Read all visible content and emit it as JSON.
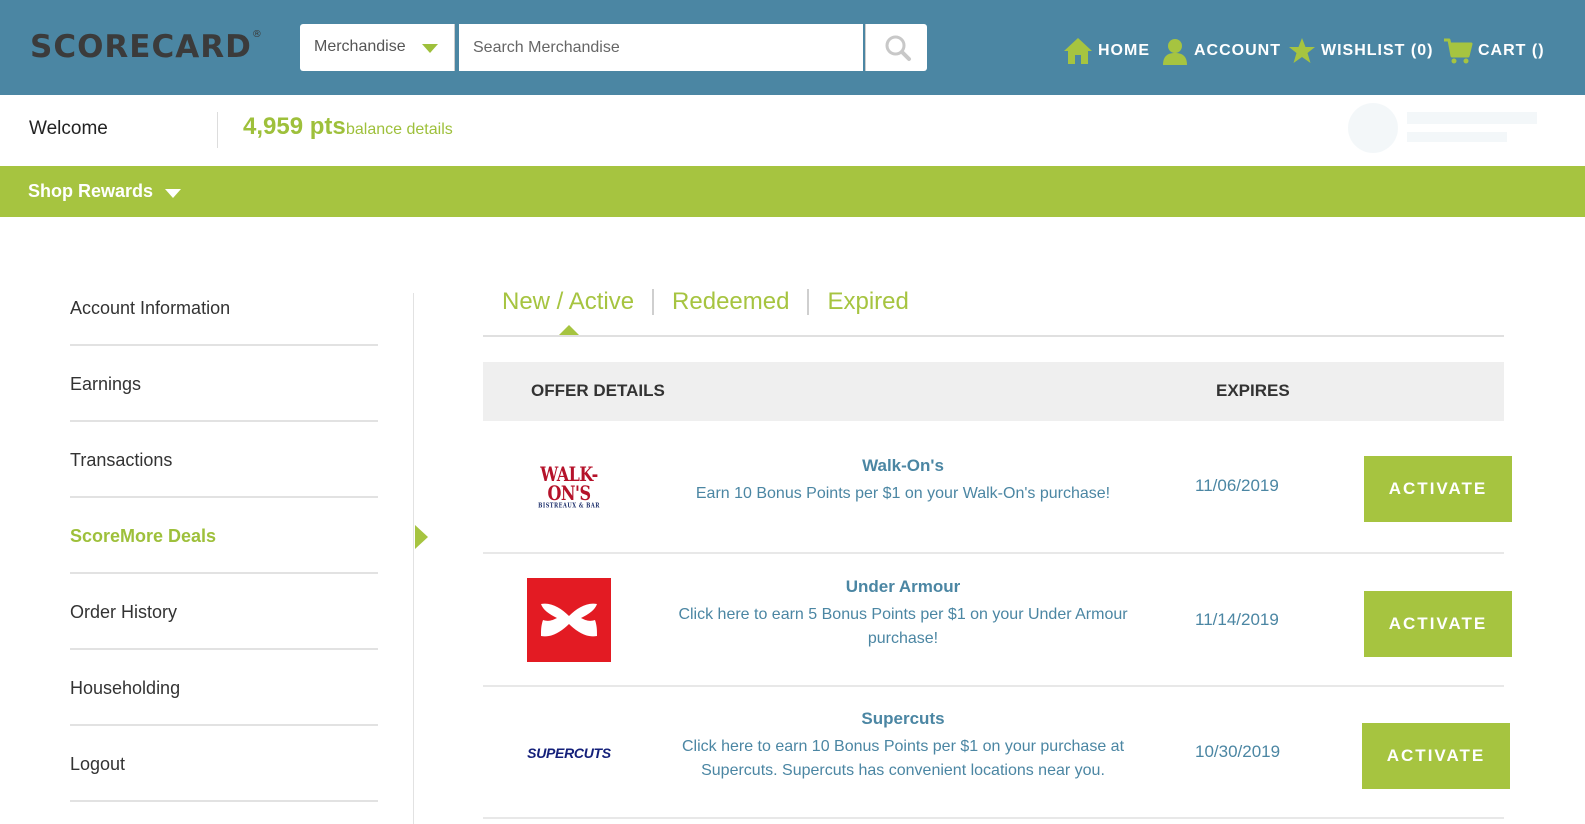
{
  "header": {
    "logo_text": "SCORECARD",
    "logo_mark": "®",
    "category_select": "Merchandise",
    "search_placeholder": "Search Merchandise",
    "nav": {
      "home": "HOME",
      "account": "ACCOUNT",
      "wishlist": "WISHLIST (0)",
      "cart": "CART ()"
    }
  },
  "welcome": {
    "label": "Welcome",
    "points": "4,959 pts",
    "balance_link": "balance details"
  },
  "menu": {
    "shop_rewards": "Shop Rewards"
  },
  "sidebar": {
    "items": [
      {
        "label": "Account Information",
        "active": false
      },
      {
        "label": "Earnings",
        "active": false
      },
      {
        "label": "Transactions",
        "active": false
      },
      {
        "label": "ScoreMore Deals",
        "active": true
      },
      {
        "label": "Order History",
        "active": false
      },
      {
        "label": "Householding",
        "active": false
      },
      {
        "label": "Logout",
        "active": false
      }
    ]
  },
  "tabs": [
    {
      "label": "New / Active",
      "active": true
    },
    {
      "label": "Redeemed",
      "active": false
    },
    {
      "label": "Expired",
      "active": false
    }
  ],
  "table": {
    "col_offer": "OFFER DETAILS",
    "col_expires": "EXPIRES",
    "rows": [
      {
        "brand": "Walk-On's",
        "logo_text": "WALK-ON'S",
        "logo_subtext": "BISTREAUX & BAR",
        "description": "Earn 10 Bonus Points per $1 on your Walk-On's purchase!",
        "expires": "11/06/2019",
        "action": "ACTIVATE"
      },
      {
        "brand": "Under Armour",
        "logo_icon": "under-armour-logo",
        "description": "Click here to earn 5 Bonus Points per $1 on your Under Armour purchase!",
        "expires": "11/14/2019",
        "action": "ACTIVATE"
      },
      {
        "brand": "Supercuts",
        "logo_text": "SUPERCUTS",
        "description": "Click here to earn 10 Bonus Points per $1 on your purchase at Supercuts. Supercuts has convenient locations near you.",
        "expires": "10/30/2019",
        "action": "ACTIVATE"
      }
    ]
  },
  "colors": {
    "header_bg": "#4b86a3",
    "accent_green": "#a6c440",
    "link_blue": "#4b86a3"
  },
  "icons": [
    "search-icon",
    "home-icon",
    "user-icon",
    "star-icon",
    "cart-icon",
    "caret-down-icon",
    "arrow-right-icon"
  ]
}
